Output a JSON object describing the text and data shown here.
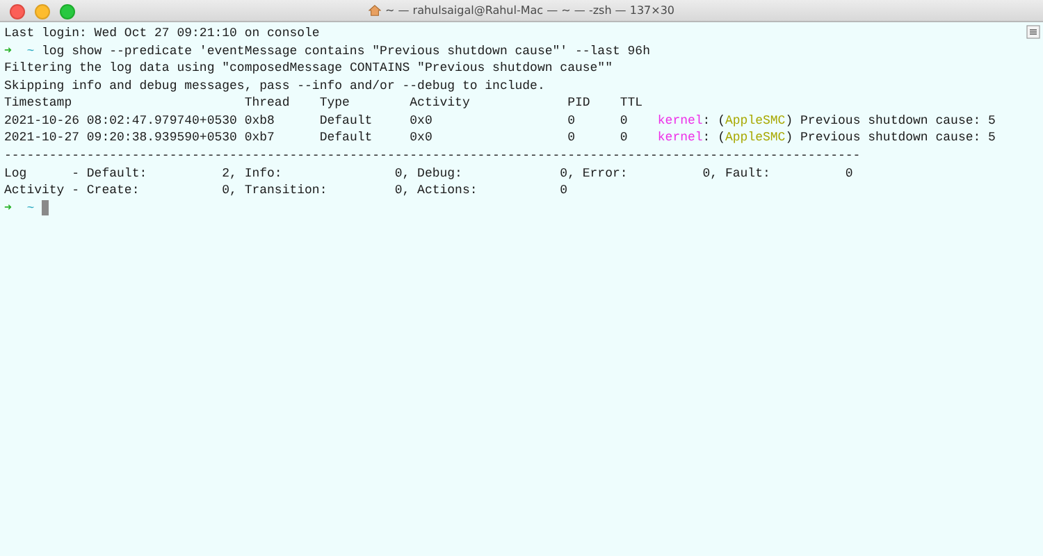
{
  "window": {
    "title": "~ — rahulsaigal@Rahul-Mac — ~ — -zsh — 137×30"
  },
  "lines": [
    {
      "kind": "output",
      "text": "Last login: Wed Oct 27 09:21:10 on console"
    },
    {
      "kind": "prompt",
      "arrow": "➜",
      "dir": "~",
      "command": "log show --predicate 'eventMessage contains \"Previous shutdown cause\"' --last 96h",
      "cursor": false
    },
    {
      "kind": "output",
      "text": "Filtering the log data using \"composedMessage CONTAINS \"Previous shutdown cause\"\""
    },
    {
      "kind": "output",
      "text": "Skipping info and debug messages, pass --info and/or --debug to include."
    },
    {
      "kind": "output",
      "text": "Timestamp                       Thread    Type        Activity             PID    TTL"
    },
    {
      "kind": "entry",
      "prefix": "2021-10-26 08:02:47.979740+0530 0xb8      Default     0x0                  0      0    ",
      "process": "kernel",
      "middle": ": (",
      "subsystem": "AppleSMC",
      "message": ") Previous shutdown cause: 5"
    },
    {
      "kind": "entry",
      "prefix": "2021-10-27 09:20:38.939590+0530 0xb7      Default     0x0                  0      0    ",
      "process": "kernel",
      "middle": ": (",
      "subsystem": "AppleSMC",
      "message": ") Previous shutdown cause: 5"
    },
    {
      "kind": "output",
      "text": "------------------------------------------------------------------------------------------------------------------"
    },
    {
      "kind": "output",
      "text": "Log      - Default:          2, Info:               0, Debug:             0, Error:          0, Fault:          0"
    },
    {
      "kind": "output",
      "text": "Activity - Create:           0, Transition:         0, Actions:           0"
    },
    {
      "kind": "prompt",
      "arrow": "➜",
      "dir": "~",
      "cursor": true
    }
  ]
}
